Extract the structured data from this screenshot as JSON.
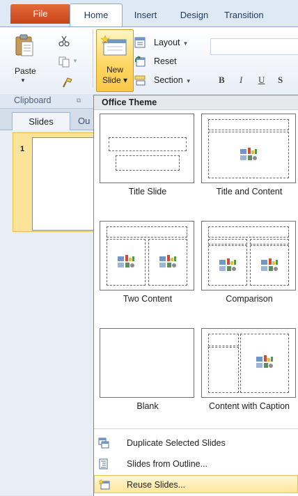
{
  "tabs": {
    "file": "File",
    "home": "Home",
    "insert": "Insert",
    "design": "Design",
    "transitions": "Transition"
  },
  "ribbon": {
    "paste_label": "Paste",
    "new_slide_line1": "New",
    "new_slide_line2": "Slide ▾",
    "layout_label": "Layout",
    "reset_label": "Reset",
    "section_label": "Section",
    "bold": "B",
    "italic": "I",
    "underline": "U",
    "strike": "S"
  },
  "groups": {
    "clipboard": "Clipboard"
  },
  "pane": {
    "slides_tab": "Slides",
    "outline_tab": "Ou",
    "slide_number": "1"
  },
  "dropdown": {
    "header": "Office Theme",
    "layouts": [
      {
        "label": "Title Slide"
      },
      {
        "label": "Title and Content"
      },
      {
        "label": "Two Content"
      },
      {
        "label": "Comparison"
      },
      {
        "label": "Blank"
      },
      {
        "label": "Content with Caption"
      }
    ],
    "menu": {
      "duplicate": "Duplicate Selected Slides",
      "outline": "Slides from Outline...",
      "reuse": "Reuse Slides..."
    }
  },
  "colors": {
    "file_tab": "#c8421a",
    "highlight": "#ffd764",
    "ribbon_bg": "#dfe9f5"
  }
}
